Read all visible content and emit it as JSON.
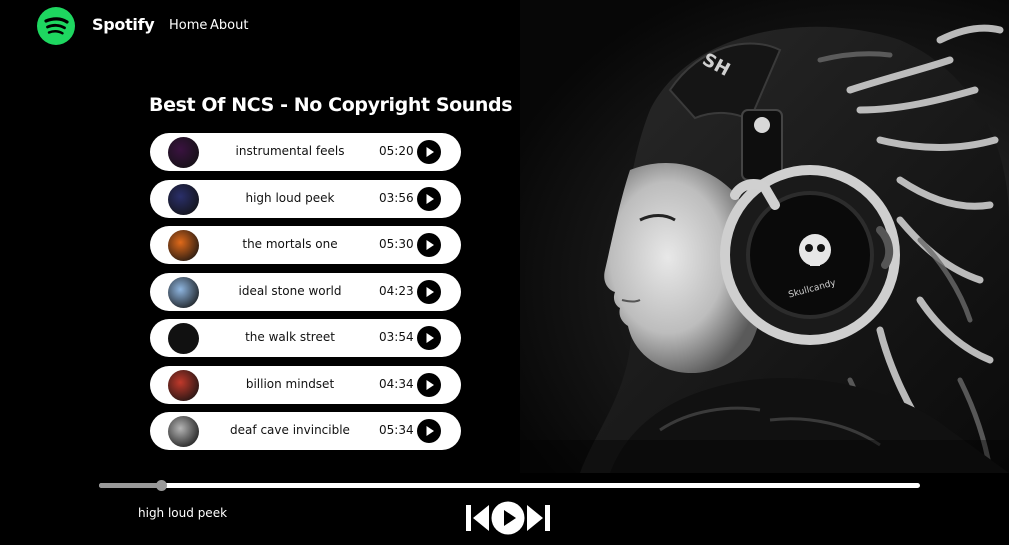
{
  "nav": {
    "brand": "Spotify",
    "links": [
      "Home",
      "About"
    ]
  },
  "playlist": {
    "title": "Best Of NCS - No Copyright Sounds",
    "songs": [
      {
        "name": "instrumental feels",
        "duration": "05:20",
        "thumb_color": "#3a1240"
      },
      {
        "name": "high loud peek",
        "duration": "03:56",
        "thumb_color": "#2a2f6a"
      },
      {
        "name": "the mortals one",
        "duration": "05:30",
        "thumb_color": "#e06a1a"
      },
      {
        "name": "ideal stone world",
        "duration": "04:23",
        "thumb_color": "#8fb6e0"
      },
      {
        "name": "the walk street",
        "duration": "03:54",
        "thumb_color": "#111111"
      },
      {
        "name": "billion mindset",
        "duration": "04:34",
        "thumb_color": "#c0392b"
      },
      {
        "name": "deaf cave invincible",
        "duration": "05:34",
        "thumb_color": "#b5b5b5"
      }
    ]
  },
  "player": {
    "now_playing": "high loud peek",
    "progress": 0.075
  },
  "colors": {
    "brand_green": "#1ed760",
    "background": "#000000",
    "row_background": "#ffffff"
  },
  "icons": {
    "brand": "spotify-logo-icon",
    "row_play": "play-icon",
    "previous": "previous-track-icon",
    "play_pause": "play-circle-icon",
    "next": "next-track-icon"
  }
}
